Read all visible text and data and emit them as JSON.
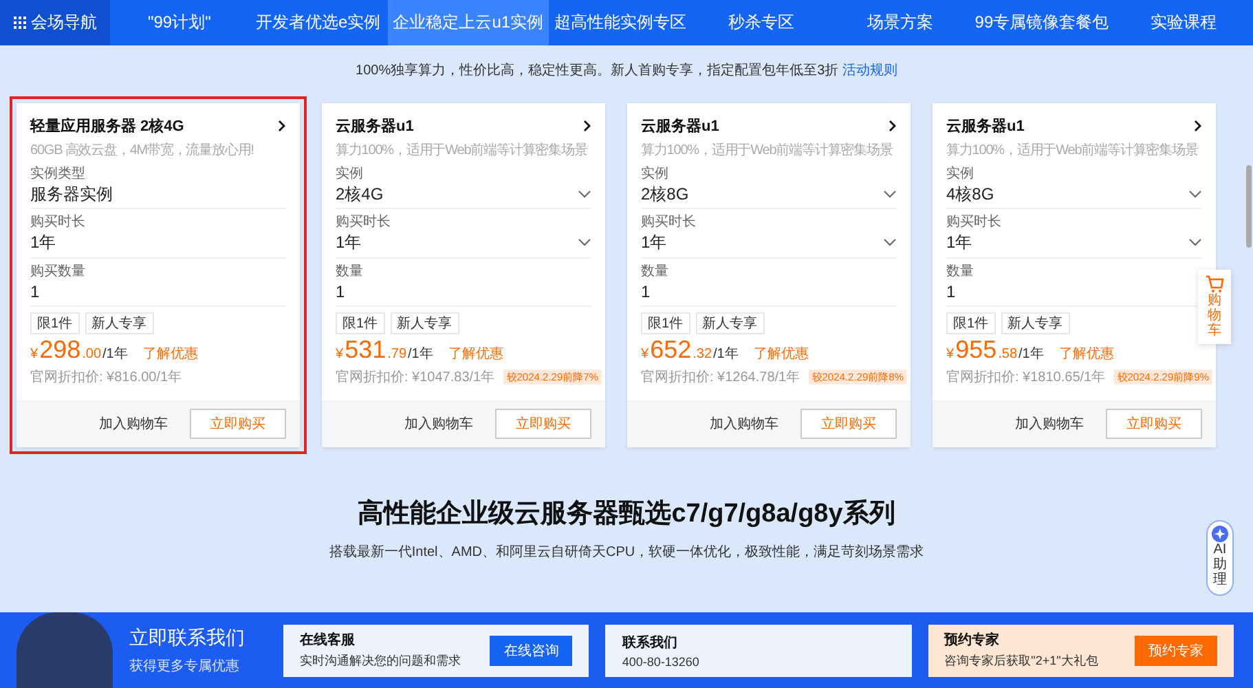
{
  "nav": {
    "items": [
      {
        "label": "会场导航",
        "kind": "menu",
        "selected": false
      },
      {
        "label": "\"99计划\"",
        "kind": "link",
        "selected": false
      },
      {
        "label": "开发者优选e实例",
        "kind": "link",
        "selected": false
      },
      {
        "label": "企业稳定上云u1实例",
        "kind": "link",
        "selected": true
      },
      {
        "label": "超高性能实例专区",
        "kind": "link",
        "selected": false
      },
      {
        "label": "秒杀专区",
        "kind": "link",
        "selected": false
      },
      {
        "label": "场景方案",
        "kind": "link",
        "selected": false
      },
      {
        "label": "99专属镜像套餐包",
        "kind": "link",
        "selected": false
      },
      {
        "label": "实验课程",
        "kind": "link",
        "selected": false
      }
    ]
  },
  "intro": {
    "text": "100%独享算力，性价比高，稳定性更高。新人首购专享，指定配置包年低至3折",
    "link": "活动规则"
  },
  "cards": [
    {
      "selected": true,
      "title": "轻量应用服务器 2核4G",
      "desc": "60GB 高效云盘，4M带宽，流量放心用!",
      "fields": [
        {
          "label": "实例类型",
          "value": "服务器实例",
          "dropdown": false
        },
        {
          "label": "购买时长",
          "value": "1年",
          "dropdown": false
        },
        {
          "label": "购买数量",
          "value": "1",
          "dropdown": false
        }
      ],
      "tags": [
        "限1件",
        "新人专享"
      ],
      "currency": "¥",
      "price": "298",
      "cents": ".00",
      "unit": "/1年",
      "promo": "了解优惠",
      "original": "官网折扣价: ¥816.00/1年",
      "cart": "加入购物车",
      "buy": "立即购买"
    },
    {
      "selected": false,
      "title": "云服务器u1",
      "desc": "算力100%，适用于Web前端等计算密集场景",
      "fields": [
        {
          "label": "实例",
          "value": "2核4G",
          "dropdown": true
        },
        {
          "label": "购买时长",
          "value": "1年",
          "dropdown": true
        },
        {
          "label": "数量",
          "value": "1",
          "dropdown": false
        }
      ],
      "tags": [
        "限1件",
        "新人专享"
      ],
      "currency": "¥",
      "price": "531",
      "cents": ".79",
      "unit": "/1年",
      "promo": "了解优惠",
      "original": "官网折扣价: ¥1047.83/1年",
      "badge": "较2024.2.29前降7%",
      "cart": "加入购物车",
      "buy": "立即购买"
    },
    {
      "selected": false,
      "title": "云服务器u1",
      "desc": "算力100%，适用于Web前端等计算密集场景",
      "fields": [
        {
          "label": "实例",
          "value": "2核8G",
          "dropdown": true
        },
        {
          "label": "购买时长",
          "value": "1年",
          "dropdown": true
        },
        {
          "label": "数量",
          "value": "1",
          "dropdown": false
        }
      ],
      "tags": [
        "限1件",
        "新人专享"
      ],
      "currency": "¥",
      "price": "652",
      "cents": ".32",
      "unit": "/1年",
      "promo": "了解优惠",
      "original": "官网折扣价: ¥1264.78/1年",
      "badge": "较2024.2.29前降8%",
      "cart": "加入购物车",
      "buy": "立即购买"
    },
    {
      "selected": false,
      "title": "云服务器u1",
      "desc": "算力100%，适用于Web前端等计算密集场景",
      "fields": [
        {
          "label": "实例",
          "value": "4核8G",
          "dropdown": true
        },
        {
          "label": "购买时长",
          "value": "1年",
          "dropdown": true
        },
        {
          "label": "数量",
          "value": "1",
          "dropdown": false
        }
      ],
      "tags": [
        "限1件",
        "新人专享"
      ],
      "currency": "¥",
      "price": "955",
      "cents": ".58",
      "unit": "/1年",
      "promo": "了解优惠",
      "original": "官网折扣价: ¥1810.65/1年",
      "badge": "较2024.2.29前降9%",
      "cart": "加入购物车",
      "buy": "立即购买"
    }
  ],
  "float_cart": {
    "label": "购物车"
  },
  "section2": {
    "title": "高性能企业级云服务器甄选c7/g7/g8a/g8y系列",
    "subtitle": "搭载最新一代Intel、AMD、和阿里云自研倚天CPU，软硬一体优化，极致性能，满足苛刻场景需求"
  },
  "ai_assistant": {
    "label": "AI助理"
  },
  "contact_bar": {
    "title": "立即联系我们",
    "subtitle": "获得更多专属优惠",
    "panels": [
      {
        "kind": "button",
        "title": "在线客服",
        "text": "实时沟通解决您的问题和需求",
        "button": "在线咨询"
      },
      {
        "kind": "plain",
        "title": "联系我们",
        "text": "400-80-13260"
      },
      {
        "kind": "promo",
        "title": "预约专家",
        "text": "咨询专家后获取\"2+1\"大礼包",
        "button": "预约专家"
      }
    ]
  }
}
